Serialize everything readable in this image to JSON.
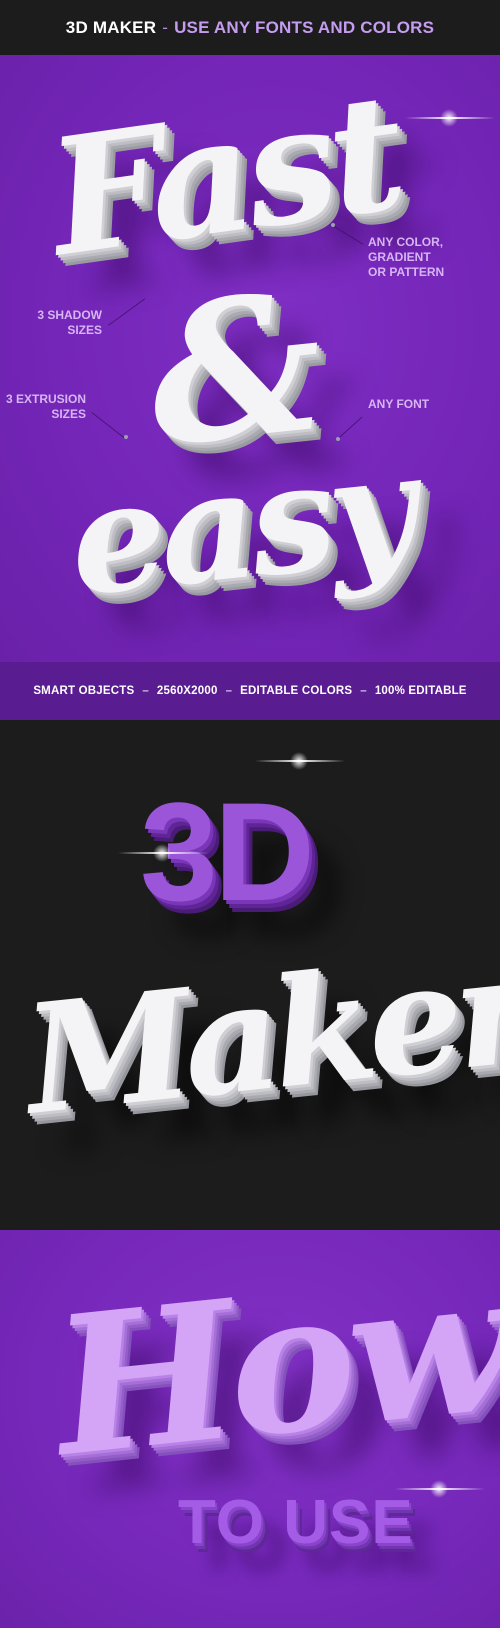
{
  "header": {
    "title_main": "3D MAKER",
    "separator": "-",
    "title_sub": "USE ANY FONTS AND COLORS"
  },
  "hero": {
    "word1": "Fast",
    "word2": "&",
    "word3": "easy",
    "annotations": {
      "color": [
        "ANY COLOR,",
        "GRADIENT",
        "OR PATTERN"
      ],
      "shadow": [
        "3 SHADOW",
        "SIZES"
      ],
      "extrusion": [
        "3 EXTRUSION",
        "SIZES"
      ],
      "font": [
        "ANY FONT"
      ]
    }
  },
  "infobar": {
    "items": [
      "SMART OBJECTS",
      "2560X2000",
      "EDITABLE COLORS",
      "100% EDITABLE"
    ],
    "separator": "–"
  },
  "dark_section": {
    "word1": "3D",
    "word2": "Maker"
  },
  "bottom_section": {
    "word1": "How",
    "word2": "TO USE"
  },
  "colors": {
    "purple_bg": "#7426b8",
    "dark_bg": "#1c1c1d",
    "infobar_bg": "#5a1c91",
    "accent_text": "#c59cf0",
    "annotation_text": "#d7b5f3",
    "threeD_purple": "#9a55d8"
  }
}
